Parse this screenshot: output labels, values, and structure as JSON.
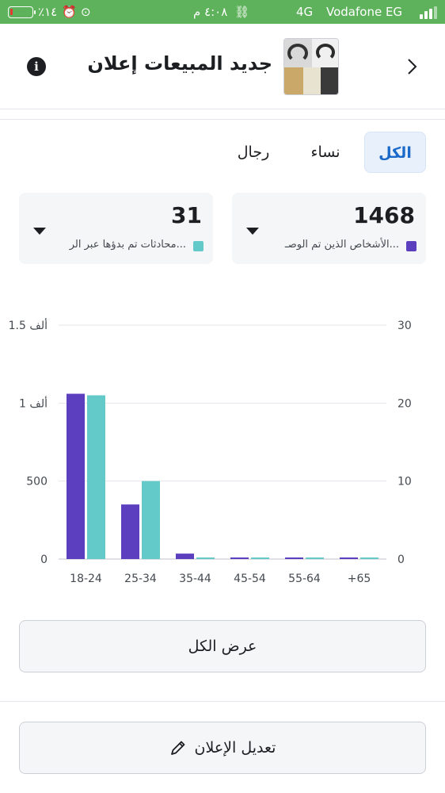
{
  "status_bar": {
    "battery_percent": "٪١٤",
    "time": "٤:٠٨ م",
    "network": "4G",
    "carrier": "Vodafone EG"
  },
  "header": {
    "title": "جديد المبيعات إعلان"
  },
  "tabs": [
    {
      "label": "الكل",
      "active": true
    },
    {
      "label": "نساء",
      "active": false
    },
    {
      "label": "رجال",
      "active": false
    }
  ],
  "metrics": [
    {
      "value": "1468",
      "label": "الأشخاص الذين تم الوصـ...",
      "color": "#5b3fbf"
    },
    {
      "value": "31",
      "label": "محادثات تم بدؤها عبر الر...",
      "color": "#64c9c9"
    }
  ],
  "chart_data": {
    "type": "bar",
    "categories": [
      "18-24",
      "25-34",
      "35-44",
      "45-54",
      "55-64",
      "+65"
    ],
    "series": [
      {
        "values": [
          1060,
          350,
          35,
          10,
          5,
          5
        ],
        "color": "#5b3fbf",
        "axis": "left"
      },
      {
        "values": [
          21,
          10,
          0.1,
          0.1,
          0.1,
          0.1
        ],
        "color": "#64c9c9",
        "axis": "right"
      }
    ],
    "left_axis": {
      "ticks": [
        "0",
        "500",
        "1 ألف",
        "1.5 ألف"
      ],
      "ylim": [
        0,
        1500
      ]
    },
    "right_axis": {
      "ticks": [
        "0",
        "10",
        "20",
        "30"
      ],
      "ylim": [
        0,
        30
      ]
    },
    "grid": true
  },
  "buttons": {
    "view_all": "عرض الكل",
    "edit_ad": "تعديل الإعلان"
  }
}
